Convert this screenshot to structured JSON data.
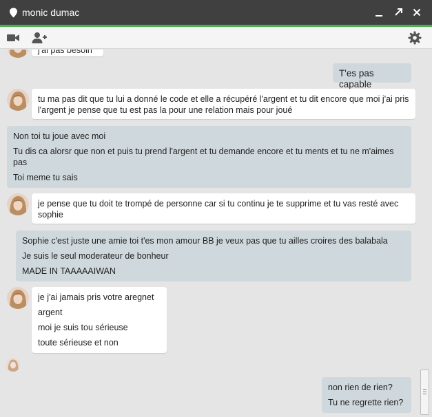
{
  "window": {
    "title": "monic dumac"
  },
  "colors": {
    "titlebar": "#404040",
    "accent": "#4caf50",
    "incoming_bubble": "#ffffff",
    "outgoing_bubble": "#cfd8dc"
  },
  "icons": {
    "window": [
      "location-pin-icon",
      "minimize-icon",
      "pop-out-icon",
      "close-icon"
    ],
    "toolbar": [
      "video-camera-icon",
      "add-person-icon",
      "gear-icon"
    ]
  },
  "messages": [
    {
      "from": "contact",
      "lines": [
        "j'ai pas besoin"
      ]
    },
    {
      "from": "me",
      "lines": [
        "T'es pas capable"
      ]
    },
    {
      "from": "contact",
      "lines": [
        "tu ma pas dit que tu lui a donné le code et elle a récupéré l'argent et tu dit encore que moi j'ai pris l'argent je pense que tu est  pas la pour une relation mais pour joué"
      ]
    },
    {
      "from": "me",
      "lines": [
        "Non toi tu joue avec moi",
        "Tu dis ca alorsr que non et puis tu prend l'argent et tu demande encore et tu ments et tu ne m'aimes pas",
        "Toi meme tu sais"
      ]
    },
    {
      "from": "contact",
      "lines": [
        "je pense que tu doit te trompé de personne car si tu continu je te supprime et tu vas resté avec sophie"
      ]
    },
    {
      "from": "me",
      "lines": [
        "Sophie c'est juste une amie toi t'es mon amour BB je veux pas que tu ailles croires des balabala",
        "Je suis le seul moderateur de bonheur",
        "MADE IN TAAAAAIWAN"
      ]
    },
    {
      "from": "contact",
      "lines": [
        "je j'ai jamais pris votre aregnet",
        "argent",
        "moi je suis tou sérieuse",
        "toute sérieuse et non"
      ]
    },
    {
      "from": "me",
      "lines": [
        "non rien de rien?",
        "Tu ne regrette rien?"
      ]
    }
  ]
}
